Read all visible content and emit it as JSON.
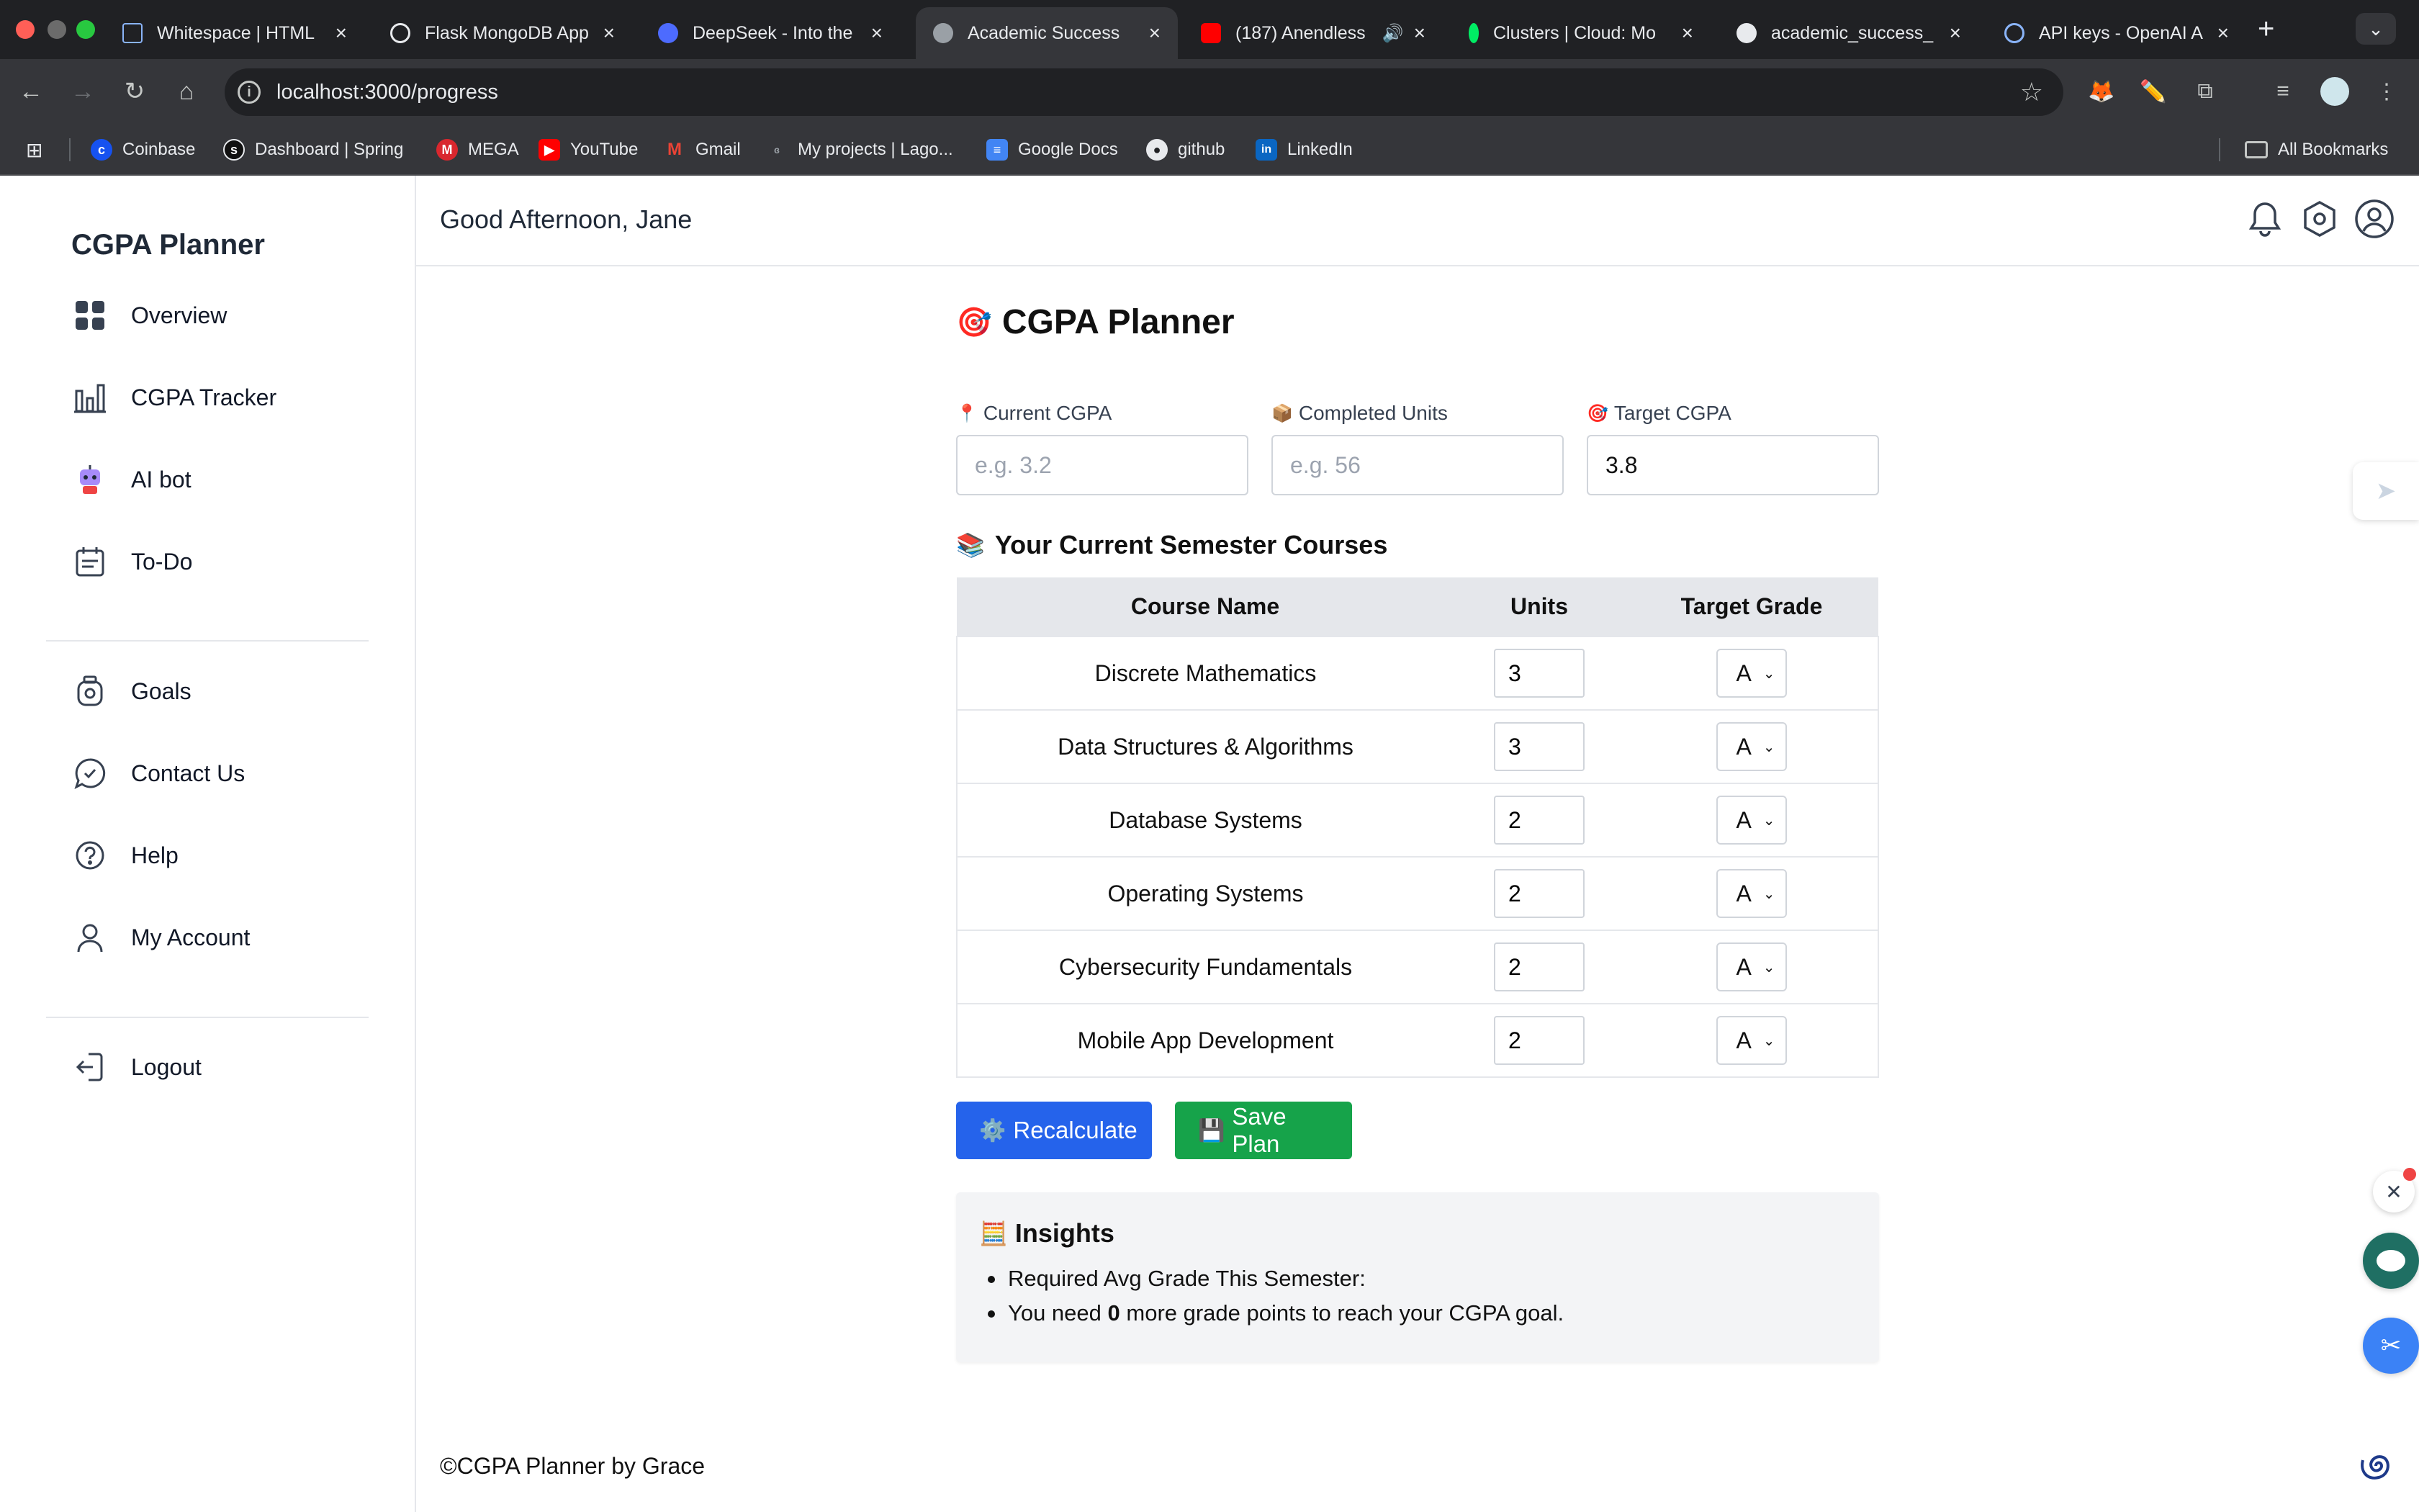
{
  "browser": {
    "tabs": [
      {
        "title": "Whitespace | HTML",
        "favicon": "whitespace-icon"
      },
      {
        "title": "Flask MongoDB App",
        "favicon": "openai-icon"
      },
      {
        "title": "DeepSeek - Into the",
        "favicon": "deepseek-icon"
      },
      {
        "title": "Academic Success",
        "favicon": "globe-icon",
        "active": true
      },
      {
        "title": "(187) Anendless",
        "favicon": "youtube-icon"
      },
      {
        "title": "Clusters | Cloud: Mo",
        "favicon": "mongodb-leaf-icon"
      },
      {
        "title": "academic_success_",
        "favicon": "github-icon"
      },
      {
        "title": "API keys - OpenAI A",
        "favicon": "openai-icon"
      }
    ],
    "tab_close": "×",
    "new_tab": "+",
    "url": "localhost:3000/progress",
    "bookmarks": [
      {
        "label": "Coinbase",
        "icon": "coinbase-icon"
      },
      {
        "label": "Dashboard | Spring",
        "icon": "spring-icon"
      },
      {
        "label": "MEGA",
        "icon": "mega-icon"
      },
      {
        "label": "YouTube",
        "icon": "youtube-icon"
      },
      {
        "label": "Gmail",
        "icon": "gmail-icon"
      },
      {
        "label": "My projects | Lago...",
        "icon": "lago-icon"
      },
      {
        "label": "Google Docs",
        "icon": "google-docs-icon"
      },
      {
        "label": "github",
        "icon": "github-icon"
      },
      {
        "label": "LinkedIn",
        "icon": "linkedin-icon"
      }
    ],
    "all_bookmarks": "All Bookmarks"
  },
  "sidebar": {
    "brand": "CGPA Planner",
    "items": [
      {
        "label": "Overview",
        "icon": "grid-icon"
      },
      {
        "label": "CGPA Tracker",
        "icon": "bar-chart-icon"
      },
      {
        "label": "AI bot",
        "icon": "robot-icon"
      },
      {
        "label": "To-Do",
        "icon": "calendar-icon"
      },
      {
        "label": "Goals",
        "icon": "goals-icon"
      },
      {
        "label": "Contact Us",
        "icon": "chat-icon"
      },
      {
        "label": "Help",
        "icon": "help-icon"
      },
      {
        "label": "My Account",
        "icon": "user-icon"
      },
      {
        "label": "Logout",
        "icon": "logout-icon"
      }
    ]
  },
  "header": {
    "greeting": "Good Afternoon, Jane"
  },
  "planner": {
    "title": "CGPA Planner",
    "title_emoji": "🎯",
    "fields": {
      "current_cgpa": {
        "label": "Current CGPA",
        "emoji": "📍",
        "placeholder": "e.g. 3.2",
        "value": ""
      },
      "completed_units": {
        "label": "Completed Units",
        "emoji": "📦",
        "placeholder": "e.g. 56",
        "value": ""
      },
      "target_cgpa": {
        "label": "Target CGPA",
        "emoji": "🎯",
        "placeholder": "",
        "value": "3.8"
      }
    },
    "courses_title": "Your Current Semester Courses",
    "courses_emoji": "📚",
    "columns": [
      "Course Name",
      "Units",
      "Target Grade"
    ],
    "courses": [
      {
        "name": "Discrete Mathematics",
        "units": "3",
        "grade": "A"
      },
      {
        "name": "Data Structures & Algorithms",
        "units": "3",
        "grade": "A"
      },
      {
        "name": "Database Systems",
        "units": "2",
        "grade": "A"
      },
      {
        "name": "Operating Systems",
        "units": "2",
        "grade": "A"
      },
      {
        "name": "Cybersecurity Fundamentals",
        "units": "2",
        "grade": "A"
      },
      {
        "name": "Mobile App Development",
        "units": "2",
        "grade": "A"
      }
    ],
    "recalculate_label": "Recalculate",
    "recalculate_emoji": "⚙️",
    "save_label": "Save Plan",
    "save_emoji": "💾",
    "insights": {
      "title": "Insights",
      "emoji": "🧮",
      "line1": "Required Avg Grade This Semester:",
      "line2_prefix": "You need ",
      "line2_value": "0",
      "line2_suffix": " more grade points to reach your CGPA goal."
    }
  },
  "footer": {
    "text": "©CGPA Planner by Grace"
  },
  "colors": {
    "primary_blue": "#2563eb",
    "save_green": "#16a34a",
    "table_header": "#e5e7eb",
    "insights_bg": "#f3f4f6"
  }
}
